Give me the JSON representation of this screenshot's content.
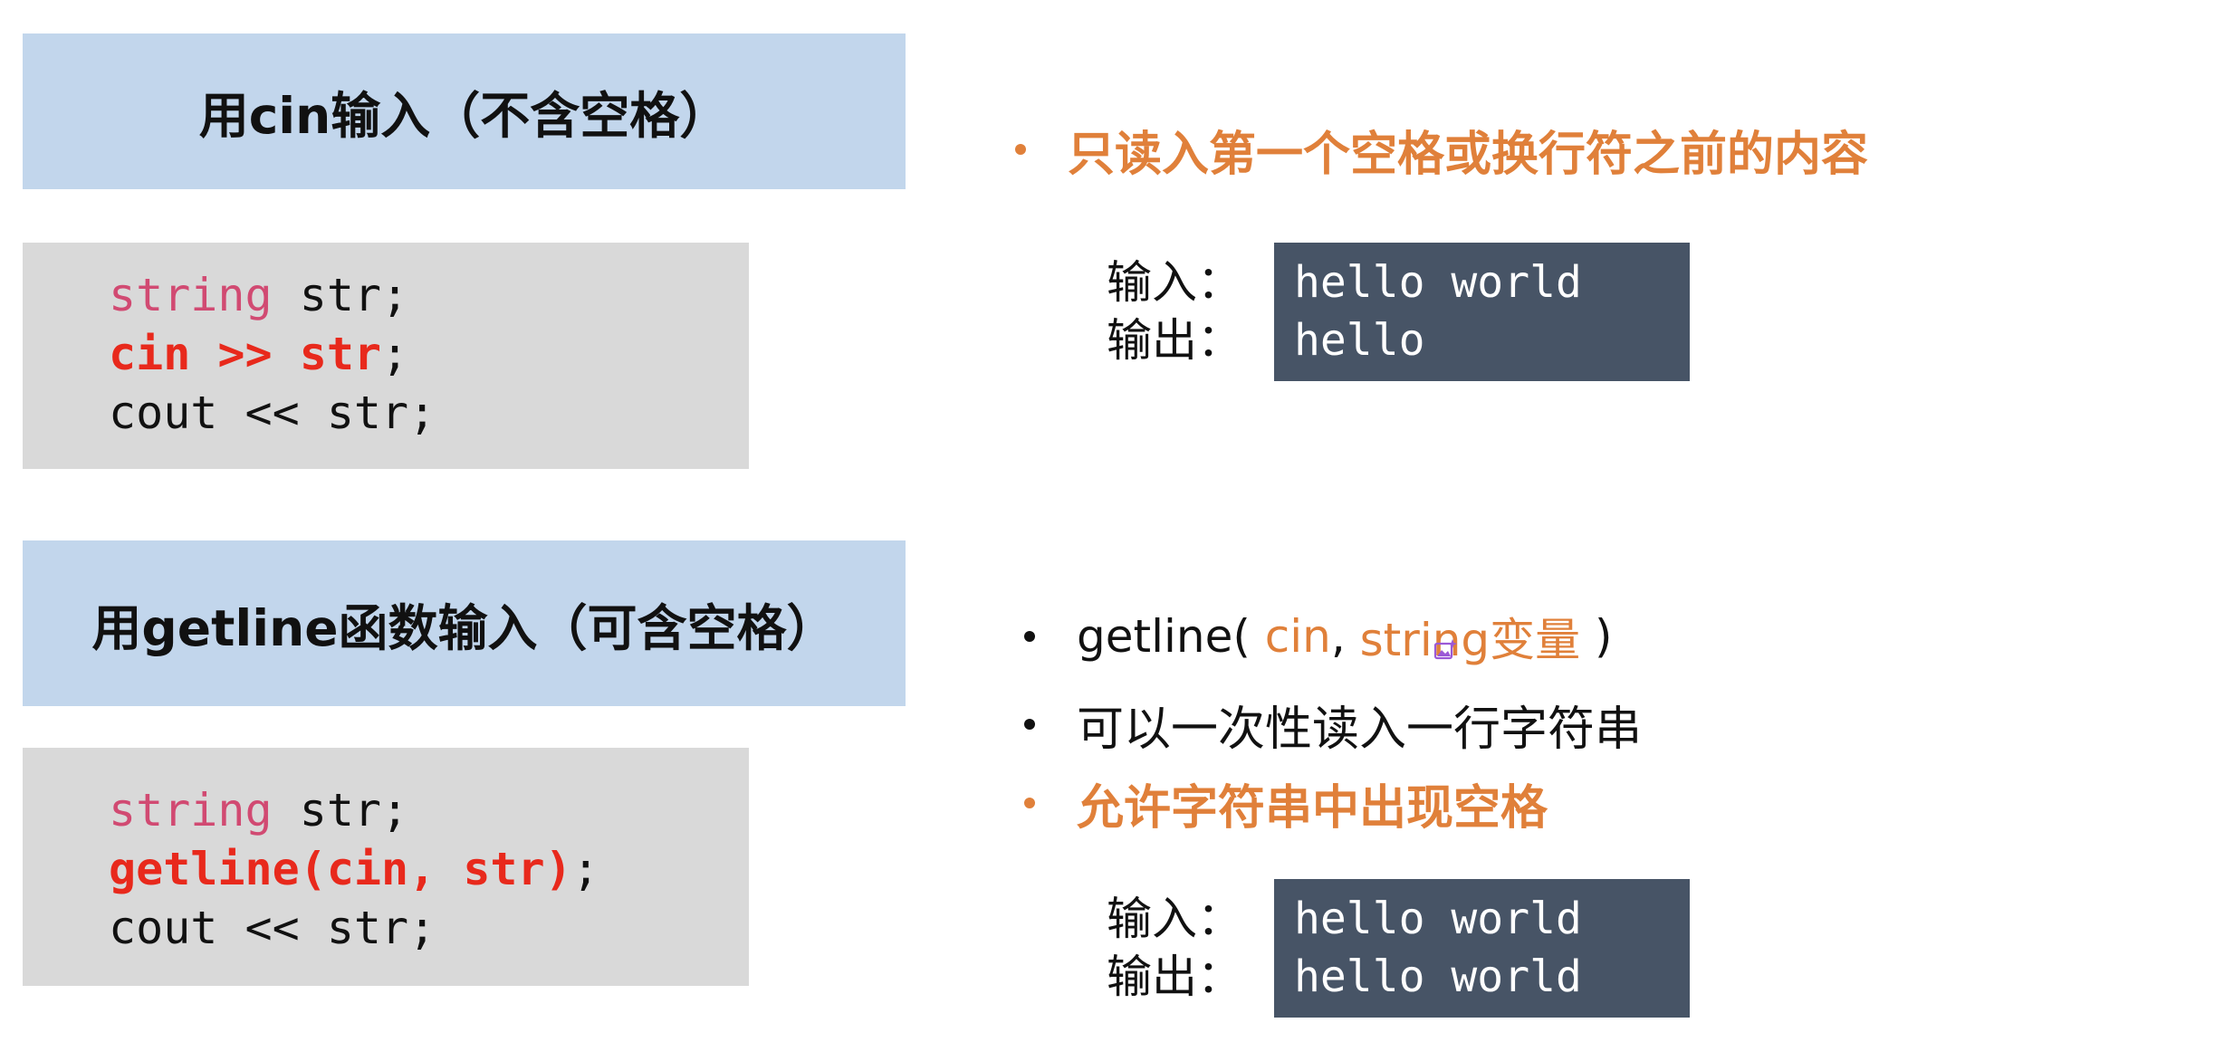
{
  "section1": {
    "title": "用cin输入（不含空格）",
    "code": {
      "line1_kw": "string",
      "line1_rest": " str;",
      "line2_hl": "cin >> str",
      "line2_rest": ";",
      "line3": "cout << str;"
    },
    "bullet": "只读入第一个空格或换行符之前的内容",
    "io": {
      "input_label": "输入：",
      "output_label": "输出：",
      "input_value": "hello world",
      "output_value": "hello"
    }
  },
  "section2": {
    "title": "用getline函数输入（可含空格）",
    "code": {
      "line1_kw": "string",
      "line1_rest": " str;",
      "line2_hl": "getline(cin, str)",
      "line2_rest": ";",
      "line3": "cout << str;"
    },
    "bullets": {
      "syntax": {
        "prefix": "getline( ",
        "arg1": "cin",
        "sep": ", ",
        "arg2": "string变量",
        "suffix": " )"
      },
      "line2": "可以一次性读入一行字符串",
      "line3": "允许字符串中出现空格"
    },
    "io": {
      "input_label": "输入：",
      "output_label": "输出：",
      "input_value": "hello world",
      "output_value": "hello world"
    }
  },
  "colors": {
    "header_bg": "#c2d6ec",
    "code_bg": "#d9d9d9",
    "keyword": "#d14a72",
    "highlight": "#e8291c",
    "accent_orange": "#e0803a",
    "io_bg": "#475466"
  },
  "icons": {
    "overlay": "image-icon"
  }
}
